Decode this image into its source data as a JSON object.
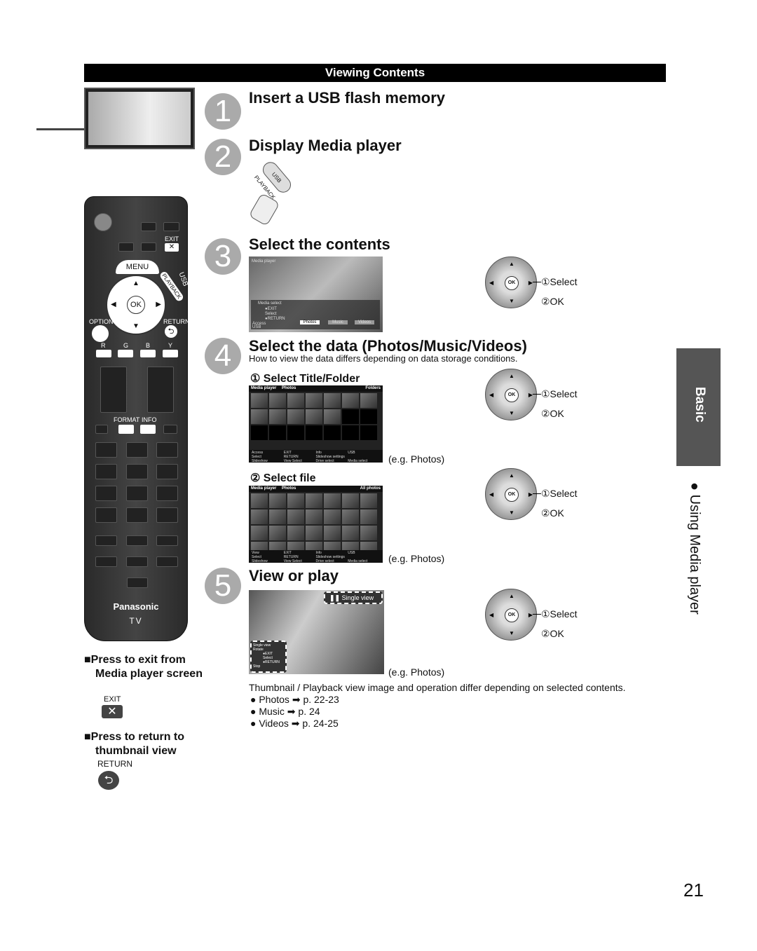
{
  "header": {
    "title": "Viewing Contents"
  },
  "steps": [
    {
      "number": "1",
      "title": "Insert a USB flash memory"
    },
    {
      "number": "2",
      "title": "Display Media player",
      "button": "USB PLAYBACK"
    },
    {
      "number": "3",
      "title": "Select the contents"
    },
    {
      "number": "4",
      "title": "Select the data (Photos/Music/Videos)",
      "note": "How to view the data differs depending on data storage conditions.",
      "sub1": "① Select Title/Folder",
      "sub2": "② Select file"
    },
    {
      "number": "5",
      "title": "View or play",
      "note": "Thumbnail / Playback view image and operation differ depending on selected contents.",
      "refs": [
        "● Photos ➡ p. 22-23",
        "● Music ➡ p. 24",
        "● Videos ➡ p. 24-25"
      ]
    }
  ],
  "dial": {
    "ok": "OK",
    "select": "①Select",
    "confirm": "②OK"
  },
  "caption": "(e.g. Photos)",
  "screen3": {
    "title": "Media player",
    "panel": "Media select",
    "keys": [
      "●EXIT",
      "Select",
      "●RETURN"
    ],
    "access": "Access",
    "usb": "USB",
    "tabs": [
      "Photos",
      "Music",
      "Videos"
    ]
  },
  "screen4a": {
    "left": "Media player  Photos",
    "right": "Folders",
    "foot": [
      "Access",
      "EXIT",
      "Info",
      "USB",
      "Select",
      "RETURN",
      "Slideshow settings",
      "",
      "Slideshow",
      "View Select",
      "Drive select",
      "Media select"
    ]
  },
  "screen4b": {
    "left": "Media player  Photos",
    "right": "All photos",
    "foot": [
      "View",
      "EXIT",
      "Info",
      "USB",
      "Select",
      "RETURN",
      "Slideshow settings",
      "",
      "Slideshow",
      "View Select",
      "Drive select",
      "Media select"
    ]
  },
  "screen5": {
    "badge": "Single view",
    "panel": [
      "Single view",
      "Rotate",
      "●EXIT",
      "Select",
      "●RETURN",
      "Stop"
    ]
  },
  "remote": {
    "exit": "EXIT",
    "menu": "MENU",
    "usb": "USB",
    "playback": "PLAYBACK",
    "ok": "OK",
    "option": "OPTION",
    "return": "RETURN",
    "colors": [
      "R",
      "G",
      "B",
      "Y"
    ],
    "format": "FORMAT",
    "info": "INFO",
    "brand": "Panasonic",
    "tv": "TV"
  },
  "notes": {
    "exit_title": "■Press to exit from Media player screen",
    "exit_label": "EXIT",
    "return_title": "■Press to return to thumbnail view",
    "return_label": "RETURN"
  },
  "side": {
    "tab": "Basic",
    "section": "● Using Media player"
  },
  "page_number": "21"
}
